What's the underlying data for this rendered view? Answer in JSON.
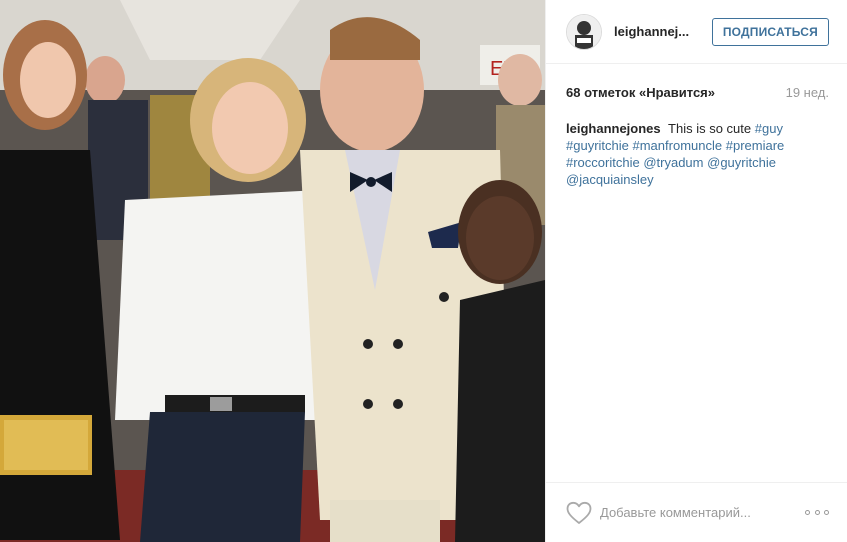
{
  "post": {
    "photo": {
      "description_icon": "photo",
      "exit_sign_text": "EX"
    },
    "header": {
      "username": "leighannej...",
      "follow_label": "ПОДПИСАТЬСЯ"
    },
    "stats": {
      "likes": "68 отметок «Нравится»",
      "age": "19 нед."
    },
    "caption": {
      "author": "leighannejones",
      "text": "This is so cute",
      "tags": [
        "#guy",
        "#guyritchie",
        "#manfromuncle",
        "#premiare",
        "#roccoritchie",
        "@tryadum",
        "@guyritchie",
        "@jacquiainsley"
      ]
    },
    "footer": {
      "comment_placeholder": "Добавьте комментарий...",
      "like_icon": "heart-outline-icon",
      "more_icon": "more-options-icon"
    }
  }
}
